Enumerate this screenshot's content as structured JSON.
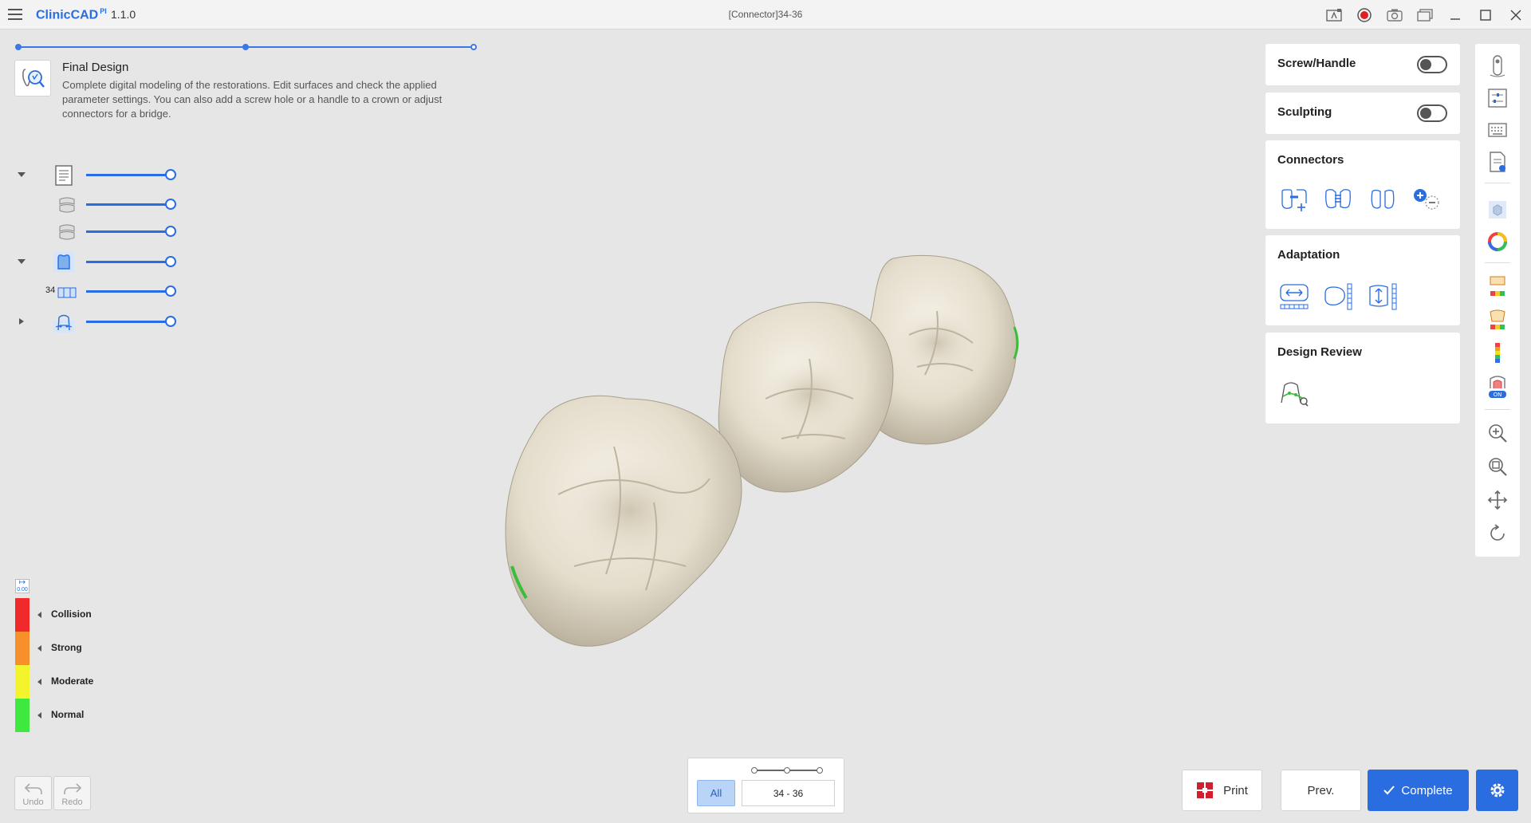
{
  "app": {
    "brand": "ClinicCAD",
    "brand_sup": "PI",
    "version": "1.1.0",
    "document_title": "[Connector]34-36"
  },
  "step": {
    "title": "Final Design",
    "description": "Complete digital modeling of the restorations. Edit surfaces and check the applied parameter settings. You can also add a screw hole or a handle to a crown or adjust connectors for a bridge."
  },
  "layers": {
    "tooth_number": "34"
  },
  "legend": {
    "items": [
      {
        "label": "Collision",
        "color": "#f02a2a"
      },
      {
        "label": "Strong",
        "color": "#f7902a"
      },
      {
        "label": "Moderate",
        "color": "#f4f42c"
      },
      {
        "label": "Normal",
        "color": "#3ee83e"
      }
    ],
    "icon_text": "0.00"
  },
  "history": {
    "undo_label": "Undo",
    "redo_label": "Redo"
  },
  "selection": {
    "all_label": "All",
    "range": "34 - 36"
  },
  "actions": {
    "print_label": "Print",
    "prev_label": "Prev.",
    "complete_label": "Complete"
  },
  "panels": {
    "screw_handle": {
      "title": "Screw/Handle",
      "enabled": false
    },
    "sculpting": {
      "title": "Sculpting",
      "enabled": false
    },
    "connectors": {
      "title": "Connectors"
    },
    "adaptation": {
      "title": "Adaptation"
    },
    "design_review": {
      "title": "Design Review"
    }
  },
  "colors": {
    "accent": "#2a6de0",
    "background": "#e6e6e6",
    "tooth": "#ebe5d7"
  }
}
